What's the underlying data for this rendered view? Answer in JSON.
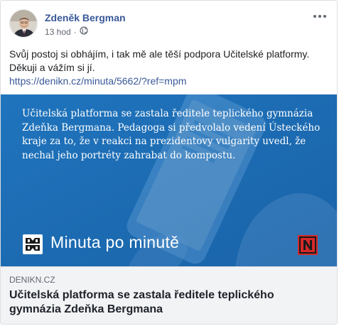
{
  "post": {
    "author": "Zdeněk Bergman",
    "time": "13 hod",
    "separator": "·",
    "privacy_icon": "globe-icon",
    "more_icon": "more-dots-icon",
    "text_line1": "Svůj postoj si obhájím, i tak mě ale těší podpora Učitelské platformy.",
    "text_line2": "Děkuji a vážím si jí.",
    "link_url": "https://denikn.cz/minuta/5662/?ref=mpm"
  },
  "preview": {
    "quote": "Učitelská platforma se zastala ředitele teplického gymnázia Zdeňka Bergmana. Pedagoga si předvolalo vedení Ústeckého kraje za to, že v reakci na prezidentovy vulgarity uvedl, že nechal jeho portréty zahrabat do kompostu.",
    "brand_text": "Minuta po minutě",
    "brand_icon": "minuta-logo-icon",
    "publisher_icon": "denik-n-logo-icon",
    "domain": "DENIKN.CZ",
    "title": "Učitelská platforma se zastala ředitele teplického gymnázia Zdeňka Bergmana"
  },
  "colors": {
    "link": "#385898",
    "image_blue": "#1e6fb8",
    "publisher_red": "#d62828"
  }
}
